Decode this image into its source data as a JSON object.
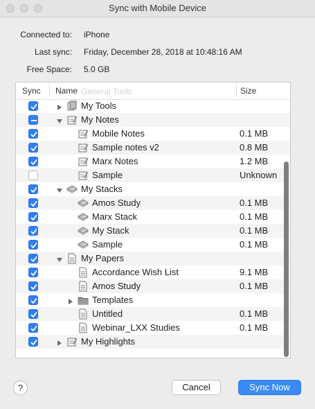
{
  "window": {
    "title": "Sync with Mobile Device"
  },
  "info": {
    "connected_label": "Connected to:",
    "connected_value": "iPhone",
    "last_sync_label": "Last sync:",
    "last_sync_value": "Friday, December 28, 2018 at 10:48:16 AM",
    "free_space_label": "Free Space:",
    "free_space_value": "5.0 GB"
  },
  "table": {
    "headers": {
      "sync": "Sync",
      "name": "Name",
      "size": "Size",
      "ghost": "General Tools"
    },
    "rows": [
      {
        "name": "My Tools",
        "size": "",
        "state": "checked",
        "level": 0,
        "disclosure": "collapsed",
        "icon": "tools-icon"
      },
      {
        "name": "My Notes",
        "size": "",
        "state": "mixed",
        "level": 0,
        "disclosure": "expanded",
        "icon": "notes-icon"
      },
      {
        "name": "Mobile Notes",
        "size": "0.1 MB",
        "state": "checked",
        "level": 1,
        "disclosure": "none",
        "icon": "notes-icon"
      },
      {
        "name": "Sample notes v2",
        "size": "0.8 MB",
        "state": "checked",
        "level": 1,
        "disclosure": "none",
        "icon": "notes-icon"
      },
      {
        "name": "Marx Notes",
        "size": "1.2 MB",
        "state": "checked",
        "level": 1,
        "disclosure": "none",
        "icon": "notes-icon"
      },
      {
        "name": "Sample",
        "size": "Unknown",
        "state": "unchecked",
        "level": 1,
        "disclosure": "none",
        "icon": "notes-icon"
      },
      {
        "name": "My Stacks",
        "size": "",
        "state": "checked",
        "level": 0,
        "disclosure": "expanded",
        "icon": "stack-icon"
      },
      {
        "name": "Amos Study",
        "size": "0.1 MB",
        "state": "checked",
        "level": 1,
        "disclosure": "none",
        "icon": "stack-icon"
      },
      {
        "name": "Marx Stack",
        "size": "0.1 MB",
        "state": "checked",
        "level": 1,
        "disclosure": "none",
        "icon": "stack-icon"
      },
      {
        "name": "My Stack",
        "size": "0.1 MB",
        "state": "checked",
        "level": 1,
        "disclosure": "none",
        "icon": "stack-icon"
      },
      {
        "name": "Sample",
        "size": "0.1 MB",
        "state": "checked",
        "level": 1,
        "disclosure": "none",
        "icon": "stack-icon"
      },
      {
        "name": "My Papers",
        "size": "",
        "state": "checked",
        "level": 0,
        "disclosure": "expanded",
        "icon": "paper-icon"
      },
      {
        "name": "Accordance Wish List",
        "size": "9.1 MB",
        "state": "checked",
        "level": 1,
        "disclosure": "none",
        "icon": "paper-icon"
      },
      {
        "name": "Amos Study",
        "size": "0.1 MB",
        "state": "checked",
        "level": 1,
        "disclosure": "none",
        "icon": "paper-icon"
      },
      {
        "name": "Templates",
        "size": "",
        "state": "checked",
        "level": 1,
        "disclosure": "collapsed",
        "icon": "folder-icon"
      },
      {
        "name": "Untitled",
        "size": "0.1 MB",
        "state": "checked",
        "level": 1,
        "disclosure": "none",
        "icon": "paper-icon"
      },
      {
        "name": "Webinar_LXX Studies",
        "size": "0.1 MB",
        "state": "checked",
        "level": 1,
        "disclosure": "none",
        "icon": "paper-icon"
      },
      {
        "name": "My Highlights",
        "size": "",
        "state": "checked",
        "level": 0,
        "disclosure": "collapsed",
        "icon": "highlights-icon"
      }
    ]
  },
  "buttons": {
    "help": "?",
    "cancel": "Cancel",
    "sync_now": "Sync Now"
  },
  "colors": {
    "accent": "#3a8bf4",
    "checkbox": "#2f7ff5"
  }
}
